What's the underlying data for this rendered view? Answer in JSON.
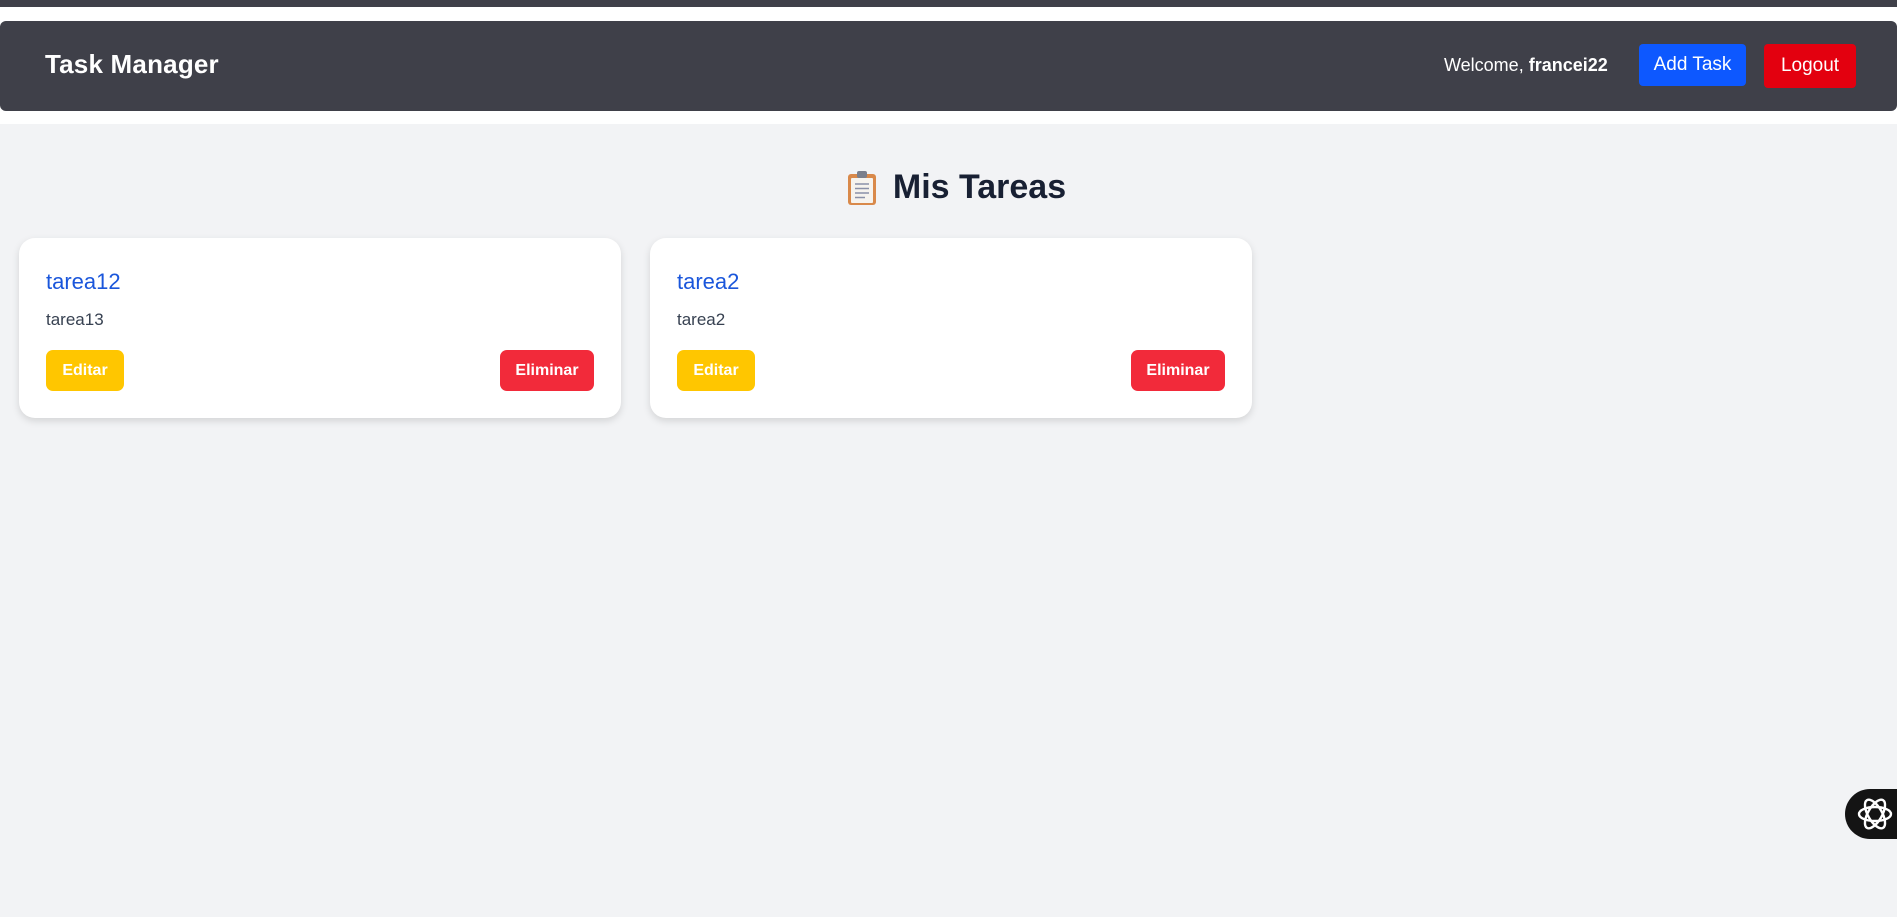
{
  "navbar": {
    "brand": "Task Manager",
    "welcome_prefix": "Welcome,",
    "username": "francei22",
    "add_task_label": "Add Task",
    "logout_label": "Logout"
  },
  "main": {
    "title": "Mis Tareas",
    "title_icon": "clipboard-icon",
    "tasks": [
      {
        "title": "tarea12",
        "description": "tarea13",
        "edit_label": "Editar",
        "delete_label": "Eliminar"
      },
      {
        "title": "tarea2",
        "description": "tarea2",
        "edit_label": "Editar",
        "delete_label": "Eliminar"
      }
    ]
  },
  "floating_widget": {
    "icon": "assistant-knot-icon"
  },
  "colors": {
    "navbar_bg": "#3f4049",
    "page_bg": "#f2f3f5",
    "add_task": "#0d58ff",
    "logout": "#e3000f",
    "edit": "#ffc600",
    "delete": "#f22a3a",
    "task_title": "#1a56db"
  }
}
